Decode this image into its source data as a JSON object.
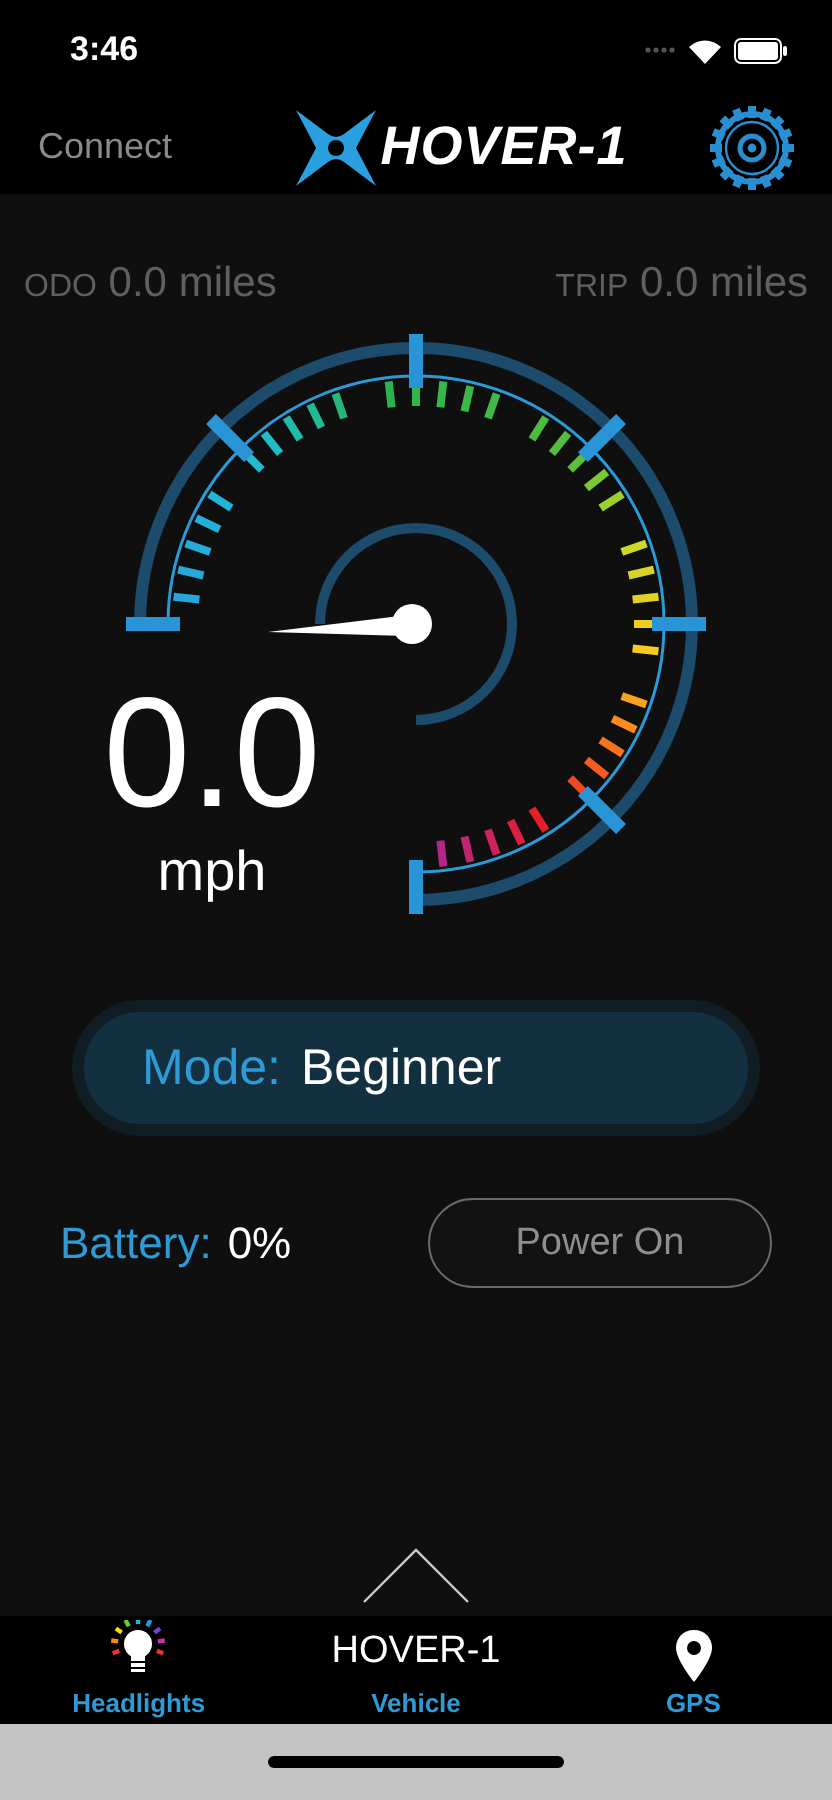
{
  "status_bar": {
    "time": "3:46"
  },
  "header": {
    "connect": "Connect",
    "logo_text": "HOVER-1"
  },
  "odometer": {
    "odo_label": "ODO",
    "odo_value": "0.0 miles",
    "trip_label": "TRIP",
    "trip_value": "0.0 miles"
  },
  "speed": {
    "value": "0.0",
    "unit": "mph"
  },
  "mode": {
    "label": "Mode:",
    "value": "Beginner"
  },
  "battery": {
    "label": "Battery:",
    "value": "0%"
  },
  "power_button": "Power On",
  "tabs": [
    {
      "label": "Headlights",
      "kind": "bulb"
    },
    {
      "label": "Vehicle",
      "kind": "brand",
      "caption": "HOVER-1"
    },
    {
      "label": "GPS",
      "kind": "pin"
    }
  ]
}
